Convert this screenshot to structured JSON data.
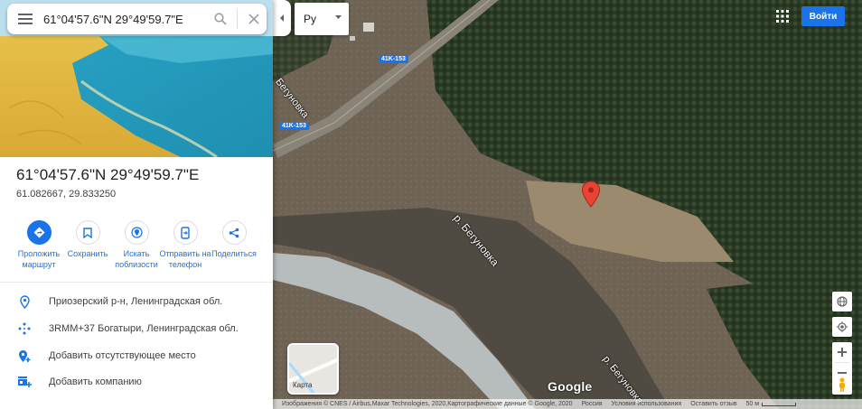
{
  "search": {
    "query": "61°04'57.6\"N 29°49'59.7\"E"
  },
  "place": {
    "title": "61°04'57.6\"N 29°49'59.7\"E",
    "coords": "61.082667, 29.833250"
  },
  "actions": [
    {
      "label": "Проложить маршрут",
      "icon": "directions-icon"
    },
    {
      "label": "Сохранить",
      "icon": "bookmark-icon"
    },
    {
      "label": "Искать поблизости",
      "icon": "nearby-icon"
    },
    {
      "label": "Отправить на телефон",
      "icon": "send-to-phone-icon"
    },
    {
      "label": "Поделиться",
      "icon": "share-icon"
    }
  ],
  "info": [
    {
      "text": "Приозерский р-н, Ленинградская обл.",
      "icon": "location-pin-icon"
    },
    {
      "text": "3RMM+37 Богатыри, Ленинградская обл.",
      "icon": "plus-code-icon"
    },
    {
      "text": "Добавить отсутствующее место",
      "icon": "add-place-icon"
    },
    {
      "text": "Добавить компанию",
      "icon": "add-business-icon"
    }
  ],
  "map": {
    "lang_value": "Ру",
    "signin_label": "Войти",
    "road_labels": [
      "41K-153",
      "41K-153"
    ],
    "street_label": "Бегуновка",
    "river_labels": [
      "р. Бегуновка",
      "р. Бегуновка"
    ],
    "layer_label": "Карта",
    "logo": "Google",
    "footer": {
      "imagery": "Изображения © CNES / Airbus,Maxar Technologies, 2020,Картографические данные © Google, 2020",
      "country": "Россия",
      "terms": "Условия использования",
      "feedback": "Оставить отзыв",
      "scale": "50 м"
    }
  },
  "colors": {
    "accent": "#1a73e8",
    "pin": "#ea4335"
  }
}
